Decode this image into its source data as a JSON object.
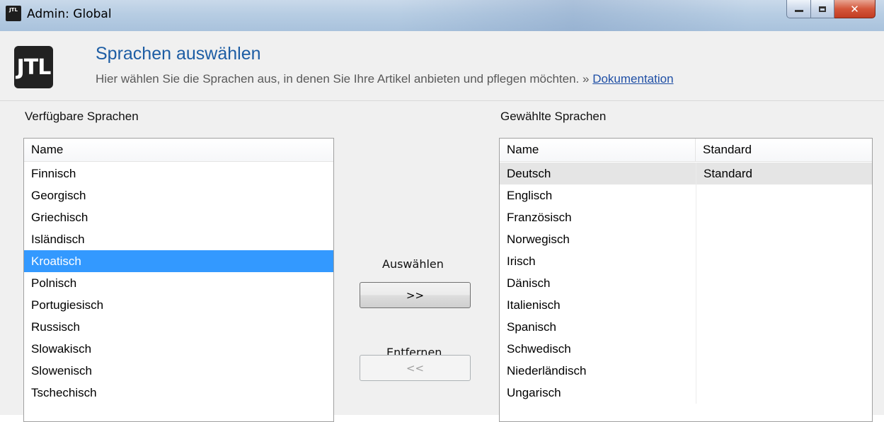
{
  "window": {
    "title": "Admin: Global",
    "app_icon_text": "JTL"
  },
  "header": {
    "title": "Sprachen auswählen",
    "subtitle": "Hier wählen Sie die Sprachen aus, in denen Sie Ihre Artikel anbieten und pflegen möchten. »",
    "doc_link": "Dokumentation",
    "logo_text": "JTL"
  },
  "available": {
    "label": "Verfügbare Sprachen",
    "column": "Name",
    "items": [
      "Finnisch",
      "Georgisch",
      "Griechisch",
      "Isländisch",
      "Kroatisch",
      "Polnisch",
      "Portugiesisch",
      "Russisch",
      "Slowakisch",
      "Slowenisch",
      "Tschechisch"
    ],
    "selected_index": 4
  },
  "actions": {
    "select_label": "Auswählen",
    "select_button": ">>",
    "remove_label": "Entfernen",
    "remove_button": "<<"
  },
  "chosen": {
    "label": "Gewählte Sprachen",
    "columns": [
      "Name",
      "Standard"
    ],
    "rows": [
      {
        "name": "Deutsch",
        "standard": "Standard"
      },
      {
        "name": "Englisch",
        "standard": ""
      },
      {
        "name": "Französisch",
        "standard": ""
      },
      {
        "name": "Norwegisch",
        "standard": ""
      },
      {
        "name": "Irisch",
        "standard": ""
      },
      {
        "name": "Dänisch",
        "standard": ""
      },
      {
        "name": "Italienisch",
        "standard": ""
      },
      {
        "name": "Spanisch",
        "standard": ""
      },
      {
        "name": "Schwedisch",
        "standard": ""
      },
      {
        "name": "Niederländisch",
        "standard": ""
      },
      {
        "name": "Ungarisch",
        "standard": ""
      }
    ]
  }
}
